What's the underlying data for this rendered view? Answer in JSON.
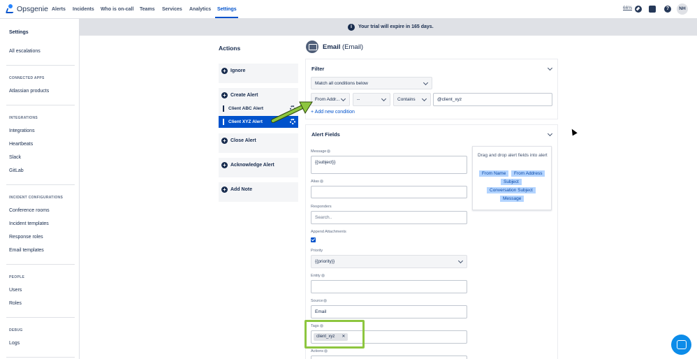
{
  "app": {
    "name": "Opsgenie"
  },
  "nav": {
    "items": [
      "Alerts",
      "Incidents",
      "Who is on-call",
      "Teams",
      "Services",
      "Analytics",
      "Settings"
    ],
    "zoom": "66%",
    "avatar": "NH"
  },
  "sidebar": {
    "title": "Settings",
    "all_escalations": "All escalations",
    "connected_apps_head": "CONNECTED APPS",
    "atlassian": "Atlassian products",
    "integrations_head": "INTEGRATIONS",
    "integrations": [
      "Integrations",
      "Heartbeats",
      "Slack",
      "GitLab"
    ],
    "incident_head": "INCIDENT CONFIGURATIONS",
    "incident": [
      "Conference rooms",
      "Incident templates",
      "Response roles",
      "Email templates"
    ],
    "people_head": "PEOPLE",
    "people": [
      "Users",
      "Roles"
    ],
    "debug_head": "DEBUG",
    "debug": [
      "Logs"
    ]
  },
  "banner": {
    "text": "Your trial will expire in 165 days."
  },
  "actions": {
    "title": "Actions",
    "ignore": "Ignore",
    "create": "Create Alert",
    "sub": [
      "Client ABC Alert",
      "Client XYZ Alert"
    ],
    "close": "Close Alert",
    "ack": "Acknowledge Alert",
    "note": "Add Note"
  },
  "integration": {
    "name": "Email",
    "type": "(Email)"
  },
  "filter": {
    "title": "Filter",
    "match": "Match all conditions below",
    "field": "From Addr...",
    "not": "--",
    "operator": "Contains",
    "value": "@client_xyz",
    "add_condition": "+ Add new condition"
  },
  "alert_fields": {
    "title": "Alert Fields",
    "message_label": "Message",
    "message_value": "{{subject}}",
    "alias_label": "Alias",
    "responders_label": "Responders",
    "responders_placeholder": "Search..",
    "append_label": "Append Attachments",
    "priority_label": "Priority",
    "priority_value": "{{priority}}",
    "entity_label": "Entity",
    "source_label": "Source",
    "source_value": "Email",
    "tags_label": "Tags",
    "tag_value": "client_xyz",
    "actions_label": "Actions"
  },
  "drag": {
    "hint": "Drag and drop alert fields into alert",
    "chips": [
      "From Name",
      "From Address",
      "Subject",
      "Conversation Subject",
      "Message"
    ]
  }
}
